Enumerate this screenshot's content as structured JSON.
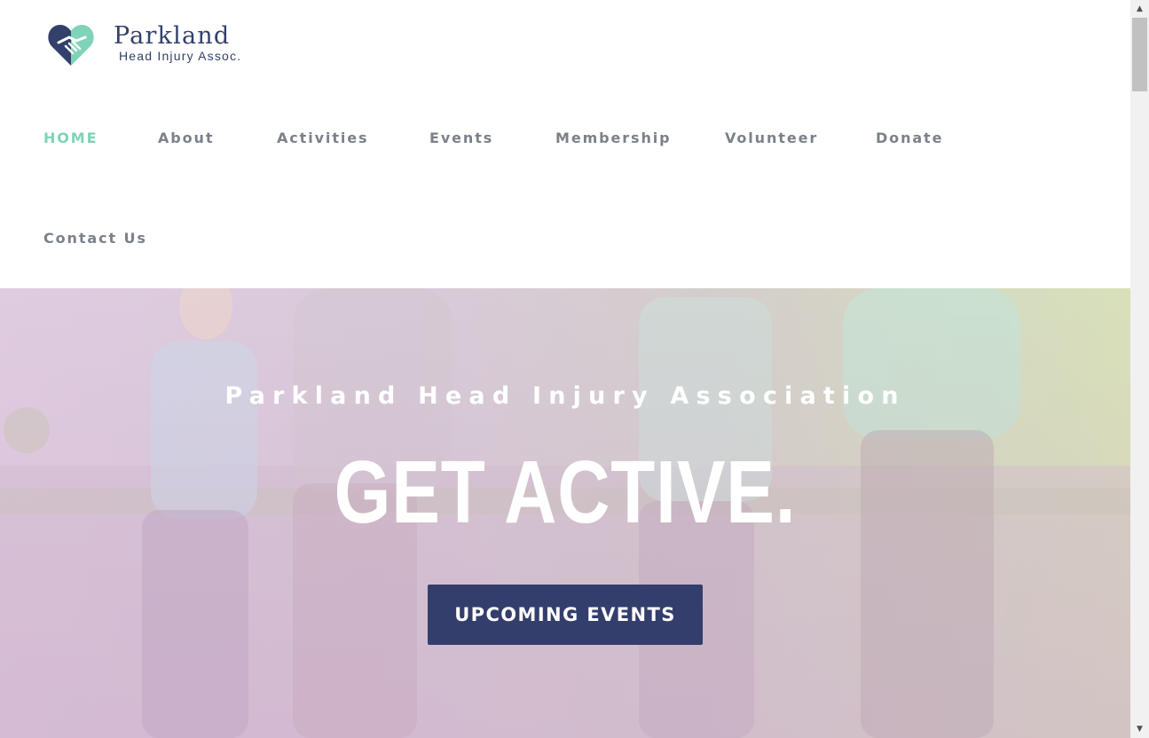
{
  "brand": {
    "name": "Parkland",
    "subtitle": "Head Injury Assoc."
  },
  "nav": {
    "items": [
      {
        "label": "HOME",
        "active": true
      },
      {
        "label": "About"
      },
      {
        "label": "Activities"
      },
      {
        "label": "Events"
      },
      {
        "label": "Membership"
      },
      {
        "label": "Volunteer"
      },
      {
        "label": "Donate"
      },
      {
        "label": "Contact Us"
      }
    ]
  },
  "hero": {
    "eyebrow": "Parkland Head Injury Association",
    "title": "GET ACTIVE.",
    "cta_label": "UPCOMING EVENTS"
  },
  "colors": {
    "accent": "#7fd3b8",
    "brand_navy": "#343e6c",
    "nav_text": "#7b8189"
  },
  "icons": {
    "logo": "heart-handshake-icon",
    "scroll_up": "triangle-up-icon",
    "scroll_down": "triangle-down-icon"
  }
}
